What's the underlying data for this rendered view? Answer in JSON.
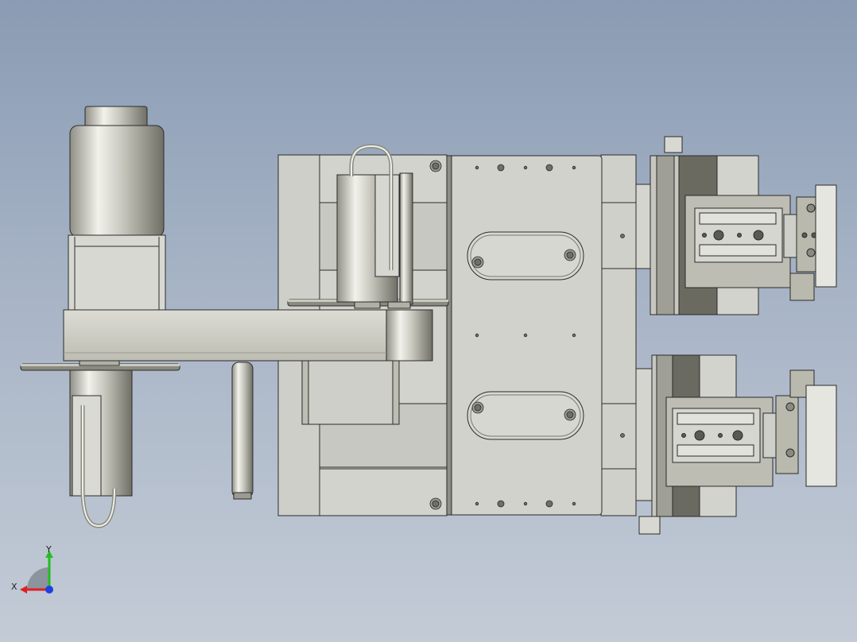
{
  "viewport": {
    "background_top": "#8a9bb3",
    "background_bottom": "#c3cbd6"
  },
  "colors": {
    "plate": "#cfcfca",
    "plate_dark": "#a9a99f",
    "edge": "#2b2b2b",
    "metal_light": "#e6e6df",
    "metal_mid": "#b9b9ae",
    "metal_dark": "#7d7d72",
    "block_dark": "#6a6a60"
  },
  "triad": {
    "x_label": "X",
    "y_label": "Y",
    "x_color": "#e02020",
    "y_color": "#20c020",
    "z_color": "#2040e0"
  }
}
